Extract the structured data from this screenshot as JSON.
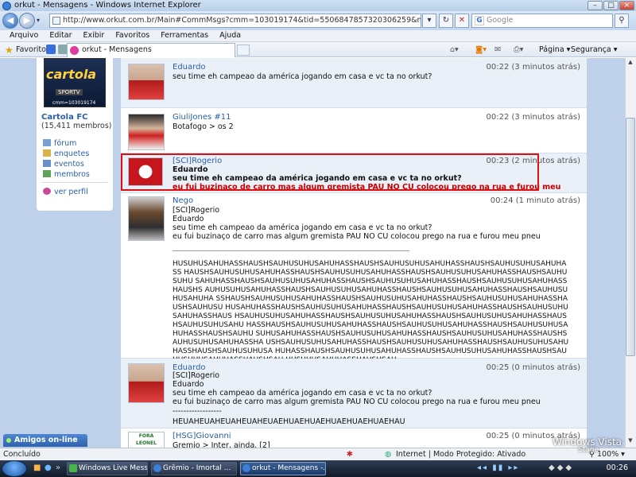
{
  "window": {
    "title": "orkut - Mensagens - Windows Internet Explorer"
  },
  "address": {
    "url": "http://www.orkut.com.br/Main#CommMsgs?cmm=103019174&tid=5506847857320306259&na=3&nst=11&nid=103019174-55",
    "search_placeholder": "Google"
  },
  "menu": [
    "Arquivo",
    "Editar",
    "Exibir",
    "Favoritos",
    "Ferramentas",
    "Ajuda"
  ],
  "favorites_label": "Favoritos",
  "tab": {
    "label": "orkut - Mensagens"
  },
  "commandbar": {
    "page_label": "Página",
    "security_label": "Segurança"
  },
  "community": {
    "logo_text": "cartola",
    "logo_brand": "SPORTV",
    "logo_id": "cmm=103019174",
    "name": "Cartola FC",
    "members": "(15,411 membros)",
    "links": [
      {
        "label": "fórum",
        "icon": "forum-icon"
      },
      {
        "label": "enquetes",
        "icon": "poll-icon"
      },
      {
        "label": "eventos",
        "icon": "calendar-icon"
      },
      {
        "label": "membros",
        "icon": "members-icon"
      },
      {
        "label": "ver perfil",
        "icon": "profile-icon"
      }
    ]
  },
  "messages": [
    {
      "author": "Eduardo",
      "time": "00:22 (3 minutos atrás)",
      "text": "seu time eh campeao da américa jogando em casa e vc ta no orkut?"
    },
    {
      "author": "GiuliJones #11",
      "time": "00:22 (3 minutos atrás)",
      "text": "Botafogo > os 2"
    },
    {
      "author": "[SCI]Rogerio",
      "time": "00:23 (2 minutos atrás)",
      "quote_name": "Eduardo",
      "quote_text": "seu time eh campeao da américa jogando em casa e vc ta no orkut?",
      "reply": "eu fui buzinaço de carro mas algum gremista PAU NO CU colocou prego na rua e furou meu pneu"
    },
    {
      "author": "Nego",
      "time": "00:24 (1 minuto atrás)",
      "quote": "[SCI]Rogerio\nEduardo\nseu time eh campeao da américa jogando em casa e vc ta no orkut?\neu fui buzinaço de carro mas algum gremista PAU NO CU colocou prego na rua e furou meu pneu",
      "laugh": "HUSUHUSAHUHASSHAUSHSAUHUSUHUSAHUHASSHAUSHSAUHUSUHUSAHUHASSHAUSHSAUHUSUHUSAHUHASS HAUSHSAUHUSUHUSAHUHASSHAUSHSAUHUSUHUSAHUHASSHAUSHSAUHUSUHUSAHUHASSHAUSHSAUHUSUHU SAHUHASSHAUSHSAUHUSUHUSAHUHASSHAUSHSAUHUSUHUSAHUHASSHAUSHSAUHUSUHUSAHUHASSHAUSHS AUHUSUHUSAHUHASSHAUSHSAUHUSUHUSAHUHASSHAUSHSAUHUSUHUSAHUHASSHAUSHSAUHUSUHUSAHUHA SSHAUSHSAUHUSUHUSAHUHASSHAUSHSAUHUSUHUSAHUHASSHAUSHSAUHUSUHUSAHUHASSHAUSHSAUHUSU HUSAHUHASSHAUSHSAUHUSUHUSAHUHASSHAUSHSAUHUSUHUSAHUHASSHAUSHSAUHUSUHUSAHUHASSHAUS HSAUHUSUHUSAHUHASSHAUSHSAUHUSUHUSAHUHASSHAUSHSAUHUSUHUSAHUHASSHAUSHSAUHUSUHUSAHU HASSHAUSHSAUHUSUHUSAHUHASSHAUSHSAUHUSUHUSAHUHASSHAUSHSAUHUSUHUSAHUHASSHAUSHSAUHU SUHUSAHUHASSHAUSHSAUHUSUHUSAHUHASSHAUSHSAUHUSUHUSAHUHASSHAUSHSAUHUSUHUSAHUHASSHA USHSAUHUSUHUSAHUHASSHAUSHSAUHUSUHUSAHUHASSHAUSHSAUHUSUHUSAHUHASSHAUSHSAUHUSUHUSA HUHASSHAUSHSAUHUSUHUSAHUHASSHAUSHSAUHUSUHUSAHUHASSHAUSHSAUHUSUHUSAHUHASSHAUSHSAU HUSUHUSAHUHASSHAUSHSAU"
    },
    {
      "author": "Eduardo",
      "time": "00:25 (0 minutos atrás)",
      "quote": "[SCI]Rogerio\nEduardo\nseu time eh campeao da américa jogando em casa e vc ta no orkut?\neu fui buzinaço de carro mas algum gremista PAU NO CU colocou prego na rua e furou meu pneu",
      "dashes": "------------------",
      "laugh": "HEUAHEUAHEUAHEUAHEUAEHUAEHUAEHUAEHUAEHUAEHAU"
    },
    {
      "author": "[HSG]Giovanni",
      "time": "00:25 (0 minutos atrás)",
      "text": "Gremio > Inter, ainda. [2]",
      "avatar_text": "FORA LEONEL"
    }
  ],
  "amigos_label": "Amigos on-line",
  "status": {
    "left": "Concluído",
    "zone": "Internet | Modo Protegido: Ativado",
    "zoom": "100%"
  },
  "taskbar": {
    "items": [
      "Windows Live Mess...",
      "Grêmio - Imortal ...",
      "orkut - Mensagens -..."
    ],
    "clock": "00:26"
  },
  "watermark": {
    "line1": "Windows Vista",
    "line2": "Stage"
  },
  "colors": {
    "accent": "#2a5fa7",
    "highlight_border": "#dd1111",
    "reply_red": "#cc0000",
    "page_bg": "#bfd0ea"
  }
}
